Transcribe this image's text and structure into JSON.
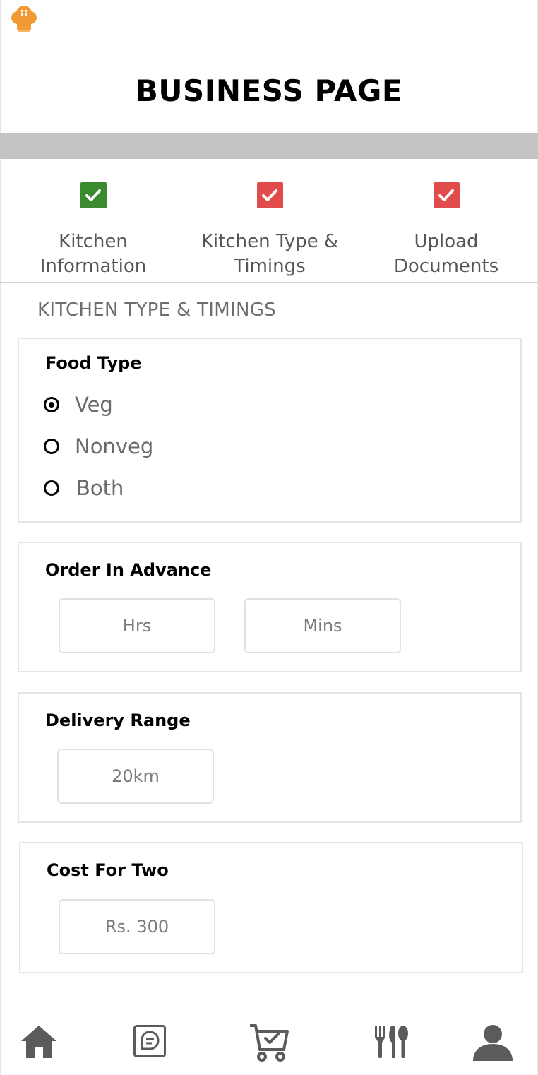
{
  "colors": {
    "logo": "#F19A36",
    "checked_green": "#3A8A2E",
    "checked_red": "#E24B4B",
    "nav_icon": "#5B5B5B",
    "bar": "#C4C4C4"
  },
  "header": {
    "title": "BUSINESS PAGE",
    "logo_icon": "chef-hat-icon"
  },
  "steps": [
    {
      "line1": "Kitchen",
      "line2": "Information",
      "checked": true,
      "color": "green"
    },
    {
      "line1": "Kitchen Type &",
      "line2": "Timings",
      "checked": true,
      "color": "red"
    },
    {
      "line1": "Upload",
      "line2": "Documents",
      "checked": true,
      "color": "red"
    }
  ],
  "section_title": "KITCHEN TYPE & TIMINGS",
  "food_type": {
    "title": "Food Type",
    "options": [
      "Veg",
      "Nonveg",
      "Both"
    ],
    "selected": "Veg"
  },
  "order_in_advance": {
    "title": "Order In Advance",
    "hours_placeholder": "Hrs",
    "minutes_placeholder": "Mins"
  },
  "delivery_range": {
    "title": "Delivery Range",
    "value": "20km"
  },
  "cost_for_two": {
    "title": "Cost For Two",
    "value": "Rs. 300"
  },
  "bottom_nav": [
    "home-icon",
    "chat-icon",
    "cart-check-icon",
    "utensils-icon",
    "profile-icon"
  ]
}
